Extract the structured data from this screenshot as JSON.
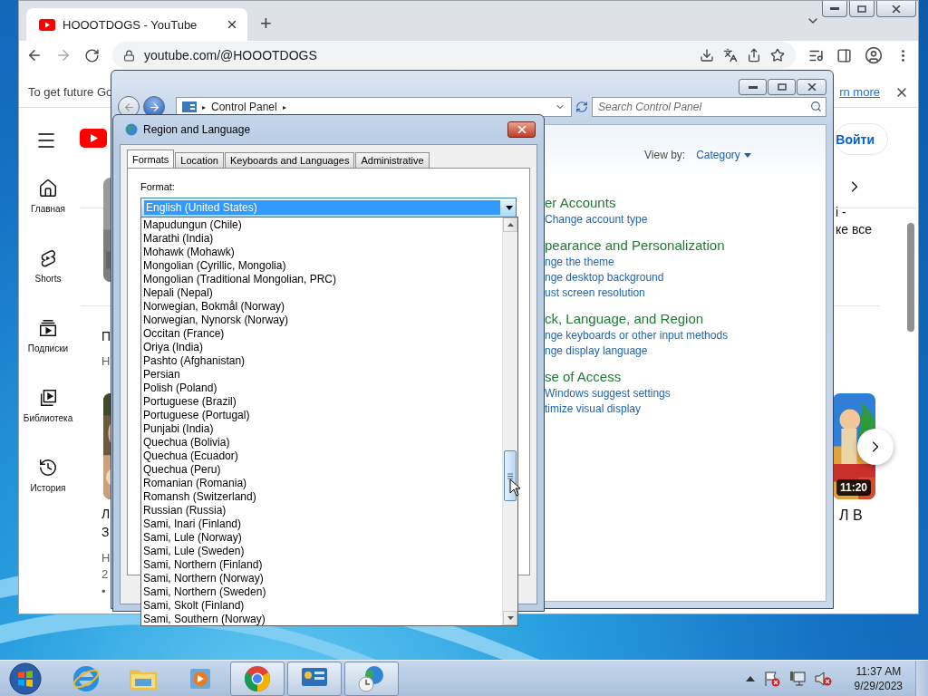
{
  "browser": {
    "tab_title": "HOOOTDOGS - YouTube",
    "new_tab": "+",
    "url": "youtube.com/@HOOOTDOGS",
    "infobar": {
      "text": "To get future Go",
      "link": "rn more"
    }
  },
  "youtube": {
    "sidebar": [
      {
        "kind": "home",
        "label": "Главная"
      },
      {
        "kind": "shorts",
        "label": "Shorts"
      },
      {
        "kind": "subscriptions",
        "label": "Подписки"
      },
      {
        "kind": "library",
        "label": "Библиотека"
      },
      {
        "kind": "history",
        "label": "История"
      }
    ],
    "signin": "Войти",
    "right_fragments": [
      "і -",
      "ке все"
    ],
    "duration": "11:20",
    "title_fragment": "Л В",
    "left_fragments": [
      {
        "kind": "title",
        "text": "П"
      },
      {
        "kind": "meta",
        "text": "Н"
      },
      {
        "kind": "title",
        "text": "Л"
      },
      {
        "kind": "title",
        "text": "З"
      },
      {
        "kind": "meta",
        "text": "Н"
      },
      {
        "kind": "meta",
        "text": "2"
      },
      {
        "kind": "meta",
        "text": "•"
      }
    ]
  },
  "control_panel": {
    "breadcrumb": [
      {
        "kind": "separator",
        "text": "▸"
      },
      {
        "kind": "item",
        "text": "Control Panel"
      },
      {
        "kind": "separator",
        "text": "▸"
      }
    ],
    "search_placeholder": "Search Control Panel",
    "view_by_label": "View by:",
    "view_by_value": "Category",
    "categories": [
      {
        "heading": "er Accounts",
        "links": [
          "Change account type"
        ]
      },
      {
        "heading": "pearance and Personalization",
        "links": [
          "nge the theme",
          "nge desktop background",
          "ust screen resolution"
        ]
      },
      {
        "heading": "ck, Language, and Region",
        "links": [
          "nge keyboards or other input methods",
          "nge display language"
        ]
      },
      {
        "heading": "se of Access",
        "links": [
          "Windows suggest settings",
          "timize visual display"
        ]
      }
    ]
  },
  "region_dialog": {
    "title": "Region and Language",
    "tabs": [
      {
        "label": "Formats",
        "selected": true
      },
      {
        "label": "Location",
        "selected": false
      },
      {
        "label": "Keyboards and Languages",
        "selected": false
      },
      {
        "label": "Administrative",
        "selected": false
      }
    ],
    "format_label": "Format:",
    "format_value": "English (United States)",
    "options": [
      "Mapudungun (Chile)",
      "Marathi (India)",
      "Mohawk (Mohawk)",
      "Mongolian (Cyrillic, Mongolia)",
      "Mongolian (Traditional Mongolian, PRC)",
      "Nepali (Nepal)",
      "Norwegian, Bokmål (Norway)",
      "Norwegian, Nynorsk (Norway)",
      "Occitan (France)",
      "Oriya (India)",
      "Pashto (Afghanistan)",
      "Persian",
      "Polish (Poland)",
      "Portuguese (Brazil)",
      "Portuguese (Portugal)",
      "Punjabi (India)",
      "Quechua (Bolivia)",
      "Quechua (Ecuador)",
      "Quechua (Peru)",
      "Romanian (Romania)",
      "Romansh (Switzerland)",
      "Russian (Russia)",
      "Sami, Inari (Finland)",
      "Sami, Lule (Norway)",
      "Sami, Lule (Sweden)",
      "Sami, Northern (Finland)",
      "Sami, Northern (Norway)",
      "Sami, Northern (Sweden)",
      "Sami, Skolt (Finland)",
      "Sami, Southern (Norway)"
    ]
  },
  "taskbar": {
    "apps": [
      {
        "kind": "ie",
        "running": false
      },
      {
        "kind": "explorer",
        "running": false
      },
      {
        "kind": "media",
        "running": false
      },
      {
        "kind": "chrome",
        "running": true
      },
      {
        "kind": "control-panel",
        "running": true
      },
      {
        "kind": "region",
        "running": true
      }
    ],
    "clock": {
      "time": "11:37 AM",
      "date": "9/29/2023"
    }
  }
}
